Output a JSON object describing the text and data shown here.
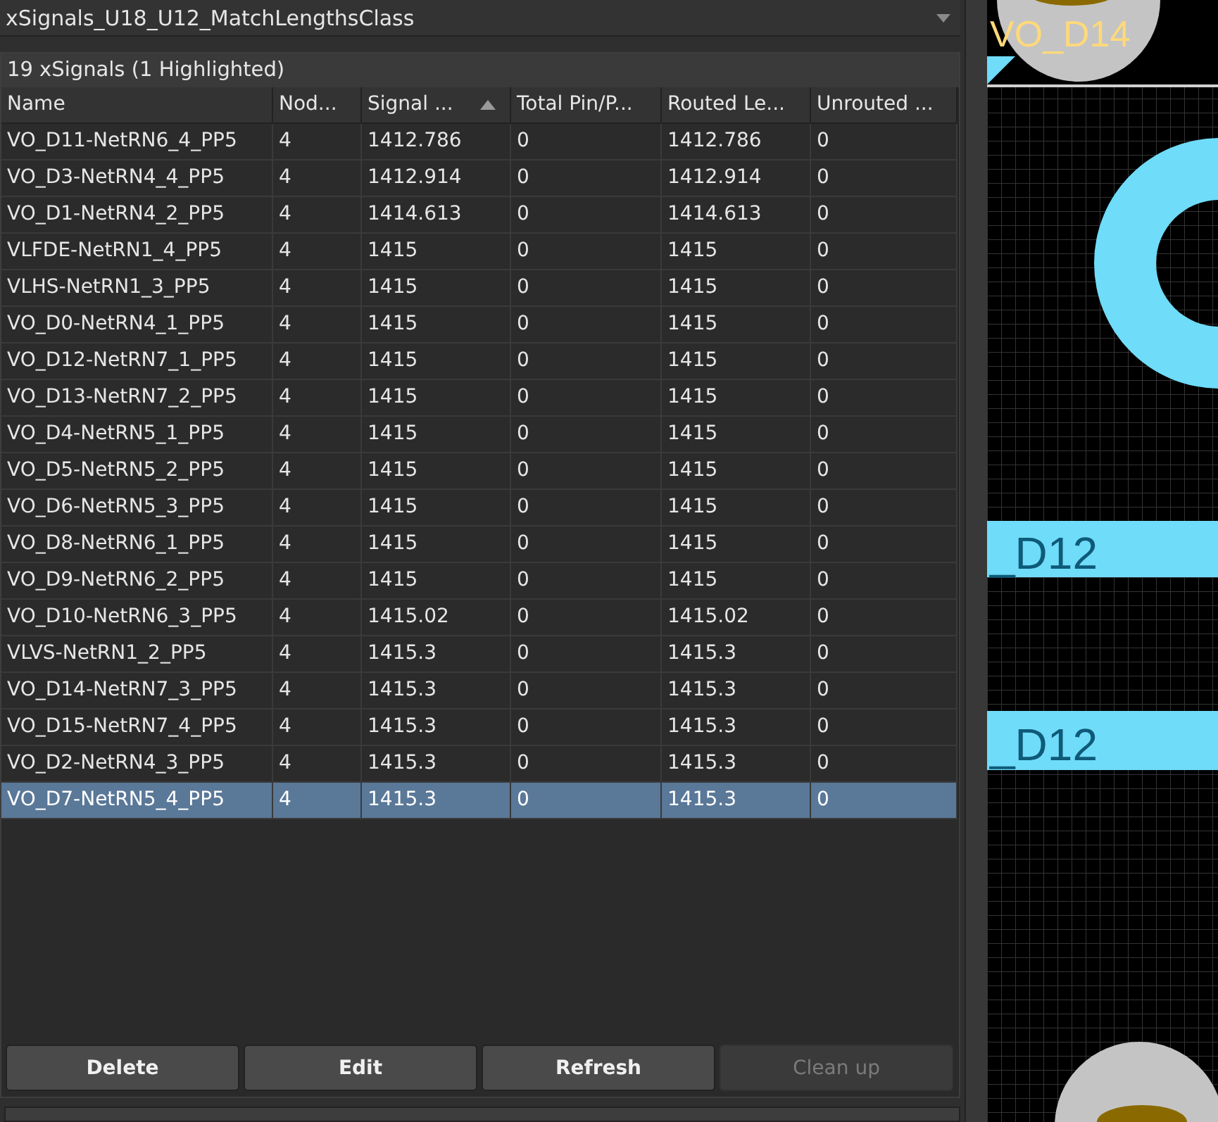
{
  "class_dropdown": {
    "value": "xSignals_U18_U12_MatchLengthsClass"
  },
  "summary": "19 xSignals (1 Highlighted)",
  "table": {
    "columns": [
      {
        "label": "Name",
        "sorted": false
      },
      {
        "label": "Nod...",
        "sorted": false
      },
      {
        "label": "Signal ...",
        "sorted": true
      },
      {
        "label": "Total Pin/P...",
        "sorted": false
      },
      {
        "label": "Routed Le...",
        "sorted": false
      },
      {
        "label": "Unrouted ...",
        "sorted": false
      }
    ],
    "rows": [
      {
        "cells": [
          "VO_D11-NetRN6_4_PP5",
          "4",
          "1412.786",
          "0",
          "1412.786",
          "0"
        ],
        "selected": false
      },
      {
        "cells": [
          "VO_D3-NetRN4_4_PP5",
          "4",
          "1412.914",
          "0",
          "1412.914",
          "0"
        ],
        "selected": false
      },
      {
        "cells": [
          "VO_D1-NetRN4_2_PP5",
          "4",
          "1414.613",
          "0",
          "1414.613",
          "0"
        ],
        "selected": false
      },
      {
        "cells": [
          "VLFDE-NetRN1_4_PP5",
          "4",
          "1415",
          "0",
          "1415",
          "0"
        ],
        "selected": false
      },
      {
        "cells": [
          "VLHS-NetRN1_3_PP5",
          "4",
          "1415",
          "0",
          "1415",
          "0"
        ],
        "selected": false
      },
      {
        "cells": [
          "VO_D0-NetRN4_1_PP5",
          "4",
          "1415",
          "0",
          "1415",
          "0"
        ],
        "selected": false
      },
      {
        "cells": [
          "VO_D12-NetRN7_1_PP5",
          "4",
          "1415",
          "0",
          "1415",
          "0"
        ],
        "selected": false
      },
      {
        "cells": [
          "VO_D13-NetRN7_2_PP5",
          "4",
          "1415",
          "0",
          "1415",
          "0"
        ],
        "selected": false
      },
      {
        "cells": [
          "VO_D4-NetRN5_1_PP5",
          "4",
          "1415",
          "0",
          "1415",
          "0"
        ],
        "selected": false
      },
      {
        "cells": [
          "VO_D5-NetRN5_2_PP5",
          "4",
          "1415",
          "0",
          "1415",
          "0"
        ],
        "selected": false
      },
      {
        "cells": [
          "VO_D6-NetRN5_3_PP5",
          "4",
          "1415",
          "0",
          "1415",
          "0"
        ],
        "selected": false
      },
      {
        "cells": [
          "VO_D8-NetRN6_1_PP5",
          "4",
          "1415",
          "0",
          "1415",
          "0"
        ],
        "selected": false
      },
      {
        "cells": [
          "VO_D9-NetRN6_2_PP5",
          "4",
          "1415",
          "0",
          "1415",
          "0"
        ],
        "selected": false
      },
      {
        "cells": [
          "VO_D10-NetRN6_3_PP5",
          "4",
          "1415.02",
          "0",
          "1415.02",
          "0"
        ],
        "selected": false
      },
      {
        "cells": [
          "VLVS-NetRN1_2_PP5",
          "4",
          "1415.3",
          "0",
          "1415.3",
          "0"
        ],
        "selected": false
      },
      {
        "cells": [
          "VO_D14-NetRN7_3_PP5",
          "4",
          "1415.3",
          "0",
          "1415.3",
          "0"
        ],
        "selected": false
      },
      {
        "cells": [
          "VO_D15-NetRN7_4_PP5",
          "4",
          "1415.3",
          "0",
          "1415.3",
          "0"
        ],
        "selected": false
      },
      {
        "cells": [
          "VO_D2-NetRN4_3_PP5",
          "4",
          "1415.3",
          "0",
          "1415.3",
          "0"
        ],
        "selected": false
      },
      {
        "cells": [
          "VO_D7-NetRN5_4_PP5",
          "4",
          "1415.3",
          "0",
          "1415.3",
          "0"
        ],
        "selected": true
      }
    ]
  },
  "buttons": [
    {
      "label": "Delete",
      "disabled": false
    },
    {
      "label": "Edit",
      "disabled": false
    },
    {
      "label": "Refresh",
      "disabled": false
    },
    {
      "label": "Clean up",
      "disabled": true
    }
  ],
  "pcb_view": {
    "labels": [
      "VO_D14",
      "_D12",
      "_D12"
    ]
  }
}
